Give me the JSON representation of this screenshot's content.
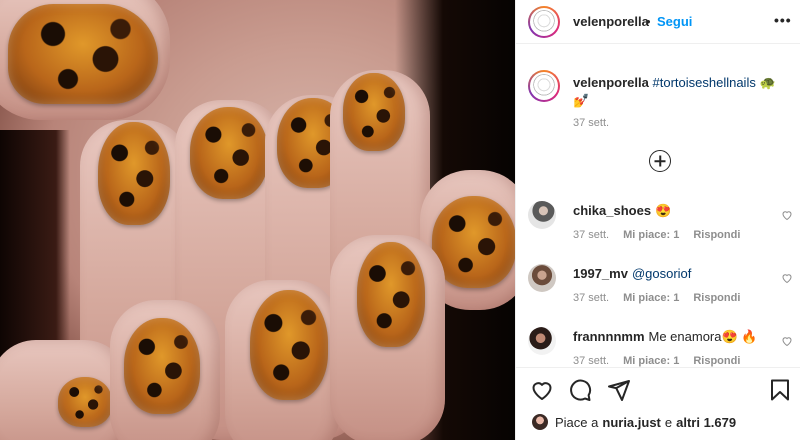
{
  "post": {
    "username": "velenporella",
    "separator": "•",
    "follow_label": "Segui",
    "more_label": "•••",
    "caption_username": "velenporella",
    "caption_hashtag": "#tortoiseshellnails",
    "caption_emoji": "🐢 💅",
    "caption_time": "37 sett.",
    "load_more_icon": "plus-circle-icon"
  },
  "comments": [
    {
      "username": "chika_shoes",
      "text": "😍",
      "time": "37 sett.",
      "likes": "Mi piace: 1",
      "reply": "Rispondi"
    },
    {
      "username": "1997_mv",
      "text": "@gosoriof",
      "time": "37 sett.",
      "likes": "Mi piace: 1",
      "reply": "Rispondi"
    },
    {
      "username": "frannnnmm",
      "text": "Me enamora😍 🔥",
      "time": "37 sett.",
      "likes": "Mi piace: 1",
      "reply": "Rispondi"
    }
  ],
  "actions": {
    "icons": [
      "heart-icon",
      "comment-icon",
      "share-icon",
      "bookmark-icon"
    ]
  },
  "likes_line": {
    "prefix": "Piace a",
    "user": "nuria.just",
    "conj": "e",
    "others": "altri 1.679"
  },
  "colors": {
    "link": "#0095f6",
    "hashtag": "#00376b",
    "muted": "#8e8e8e"
  }
}
